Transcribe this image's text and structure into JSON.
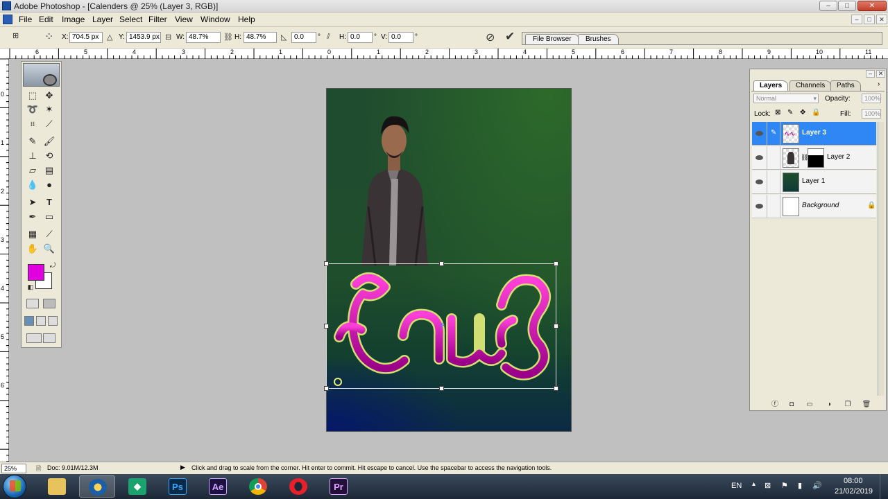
{
  "window": {
    "title": "Adobe Photoshop - [Calenders  @ 25% (Layer 3, RGB)]",
    "controls": {
      "minimize": "–",
      "maximize": "□",
      "close": "✕"
    }
  },
  "menu": [
    "File",
    "Edit",
    "Image",
    "Layer",
    "Select",
    "Filter",
    "View",
    "Window",
    "Help"
  ],
  "options_bar": {
    "x_label": "X:",
    "x_value": "704.5 px",
    "y_label": "Y:",
    "y_value": "1453.9 px",
    "w_label": "W:",
    "w_value": "48.7%",
    "h_label": "H:",
    "h_value": "48.7%",
    "angle_value": "0.0",
    "hskew_label": "H:",
    "hskew_value": "0.0",
    "vskew_label": "V:",
    "vskew_value": "0.0",
    "degree_symbol": "°",
    "cancel_icon": "cancel-transform-icon",
    "commit_icon": "commit-transform-icon",
    "palette_tabs": [
      "File Browser",
      "Brushes"
    ]
  },
  "rulers": {
    "top_labels": [
      "6",
      "5",
      "4",
      "3",
      "2",
      "1",
      "0",
      "1",
      "2",
      "3",
      "4",
      "5",
      "6",
      "7",
      "8",
      "9",
      "10",
      "11"
    ],
    "left_labels": [
      "0",
      "1",
      "2",
      "3",
      "4",
      "5",
      "6"
    ]
  },
  "layers_panel": {
    "tabs": [
      "Layers",
      "Channels",
      "Paths"
    ],
    "blend_mode": "Normal",
    "opacity_label": "Opacity:",
    "opacity_value": "100%",
    "lock_label": "Lock:",
    "fill_label": "Fill:",
    "fill_value": "100%",
    "layers": [
      {
        "name": "Layer 3",
        "selected": true
      },
      {
        "name": "Layer 2",
        "selected": false,
        "has_mask": true
      },
      {
        "name": "Layer 1",
        "selected": false
      },
      {
        "name": "Background",
        "selected": false,
        "locked": true
      }
    ]
  },
  "colors": {
    "foreground": "#e000e0",
    "background": "#ffffff",
    "selection_highlight": "#2f86f5"
  },
  "status_bar": {
    "zoom": "25%",
    "doc_info": "Doc: 9.01M/12.3M",
    "hint": "Click and drag to scale from the corner. Hit enter to commit. Hit escape to cancel. Use the spacebar to access the navigation tools."
  },
  "taskbar": {
    "apps": [
      "Ps",
      "Ae",
      "Pr"
    ],
    "language": "EN",
    "time": "08:00",
    "date": "21/02/2019"
  }
}
